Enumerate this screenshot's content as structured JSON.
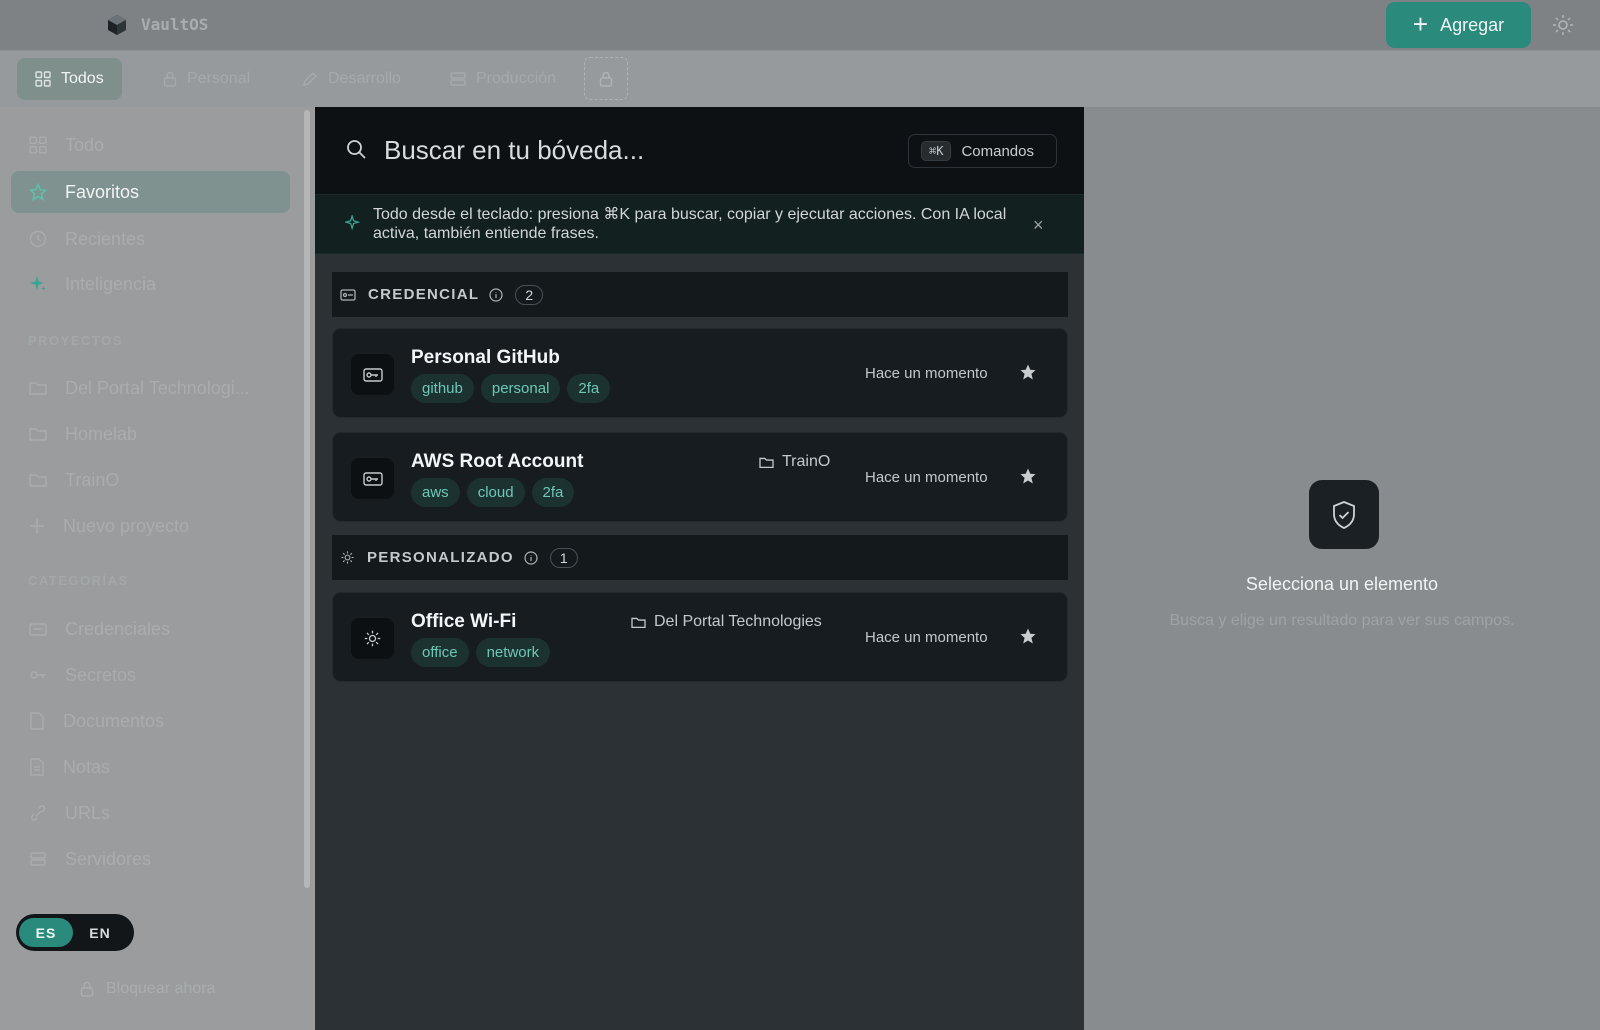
{
  "app": {
    "title": "VaultOS",
    "add_label": "Agregar"
  },
  "tabs": [
    {
      "label": "Todos",
      "icon": "grid-icon",
      "active": true
    },
    {
      "label": "Personal",
      "icon": "lock-icon"
    },
    {
      "label": "Desarrollo",
      "icon": "pencil-icon"
    },
    {
      "label": "Producción",
      "icon": "server-icon"
    }
  ],
  "sidebar": {
    "nav": [
      {
        "label": "Todo",
        "icon": "grid-icon"
      },
      {
        "label": "Favoritos",
        "icon": "star-icon",
        "active": true
      },
      {
        "label": "Recientes",
        "icon": "clock-icon"
      },
      {
        "label": "Inteligencia",
        "icon": "sparkle-icon"
      }
    ],
    "projects_label": "PROYECTOS",
    "projects": [
      {
        "label": "Del Portal Technologi..."
      },
      {
        "label": "Homelab"
      },
      {
        "label": "TrainO"
      },
      {
        "label": "Nuevo proyecto"
      }
    ],
    "categories_label": "CATEGORÍAS",
    "categories": [
      {
        "label": "Credenciales"
      },
      {
        "label": "Secretos"
      },
      {
        "label": "Documentos"
      },
      {
        "label": "Notas"
      },
      {
        "label": "URLs"
      },
      {
        "label": "Servidores"
      }
    ],
    "lang": {
      "es": "ES",
      "en": "EN",
      "active": "ES"
    },
    "lock_now": "Bloquear ahora"
  },
  "search": {
    "placeholder": "Buscar en tu bóveda...",
    "shortcut": "⌘K",
    "commands_label": "Comandos"
  },
  "tip": {
    "text": "Todo desde el teclado: presiona ⌘K para buscar, copiar y ejecutar acciones. Con IA local activa, también entiende frases."
  },
  "groups": [
    {
      "label": "CREDENCIAL",
      "count": "2",
      "items": [
        {
          "title": "Personal GitHub",
          "tags": [
            "github",
            "personal",
            "2fa"
          ],
          "folder": "",
          "time": "Hace un momento"
        },
        {
          "title": "AWS Root Account",
          "tags": [
            "aws",
            "cloud",
            "2fa"
          ],
          "folder": "TrainO",
          "time": "Hace un momento"
        }
      ]
    },
    {
      "label": "PERSONALIZADO",
      "count": "1",
      "items": [
        {
          "title": "Office Wi-Fi",
          "tags": [
            "office",
            "network"
          ],
          "folder": "Del Portal Technologies",
          "time": "Hace un momento"
        }
      ]
    }
  ],
  "detail": {
    "title": "Selecciona un elemento",
    "subtitle": "Busca y elige un resultado para ver sus campos."
  },
  "colors": {
    "accent": "#2a8a7c",
    "tag_text": "#6fc7b6",
    "tag_bg": "#1b3230"
  }
}
